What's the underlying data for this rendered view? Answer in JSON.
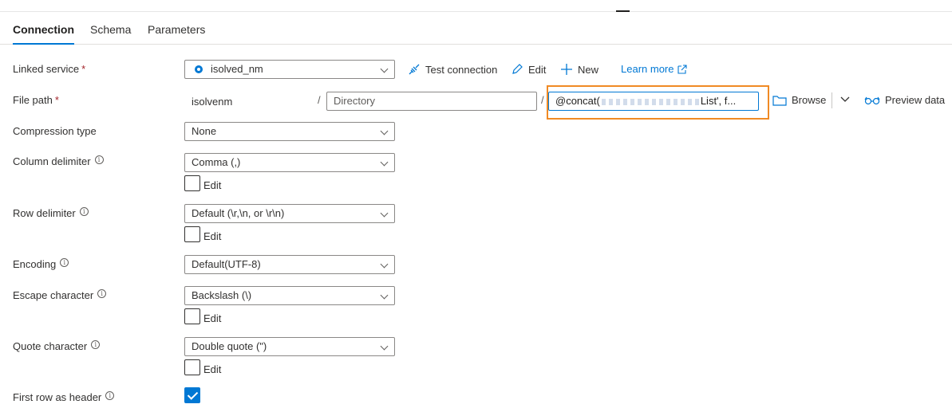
{
  "tabs": [
    {
      "label": "Connection",
      "active": true
    },
    {
      "label": "Schema",
      "active": false
    },
    {
      "label": "Parameters",
      "active": false
    }
  ],
  "linked_service": {
    "label": "Linked service",
    "required_mark": "*",
    "value": "isolved_nm",
    "icon": "linked-service-icon"
  },
  "actions": {
    "test_connection": "Test connection",
    "edit": "Edit",
    "new": "New",
    "learn_more": "Learn more"
  },
  "file_path": {
    "label": "File path",
    "required_mark": "*",
    "container": "isolvenm",
    "separator": "/",
    "directory_placeholder": "Directory",
    "file_prefix": "@concat(",
    "file_suffix": "List', f...",
    "browse": "Browse",
    "preview": "Preview data"
  },
  "fields": {
    "compression_type": {
      "label": "Compression type",
      "value": "None"
    },
    "column_delimiter": {
      "label": "Column delimiter",
      "value": "Comma (,)",
      "edit_label": "Edit"
    },
    "row_delimiter": {
      "label": "Row delimiter",
      "value": "Default (\\r,\\n, or \\r\\n)",
      "edit_label": "Edit"
    },
    "encoding": {
      "label": "Encoding",
      "value": "Default(UTF-8)"
    },
    "escape_character": {
      "label": "Escape character",
      "value": "Backslash (\\)",
      "edit_label": "Edit"
    },
    "quote_character": {
      "label": "Quote character",
      "value": "Double quote (\")",
      "edit_label": "Edit"
    },
    "first_row_as_header": {
      "label": "First row as header",
      "checked": true
    }
  },
  "info_glyph": "i",
  "colors": {
    "accent": "#0078d4",
    "highlight": "#f08a24",
    "required": "#a4262c"
  }
}
